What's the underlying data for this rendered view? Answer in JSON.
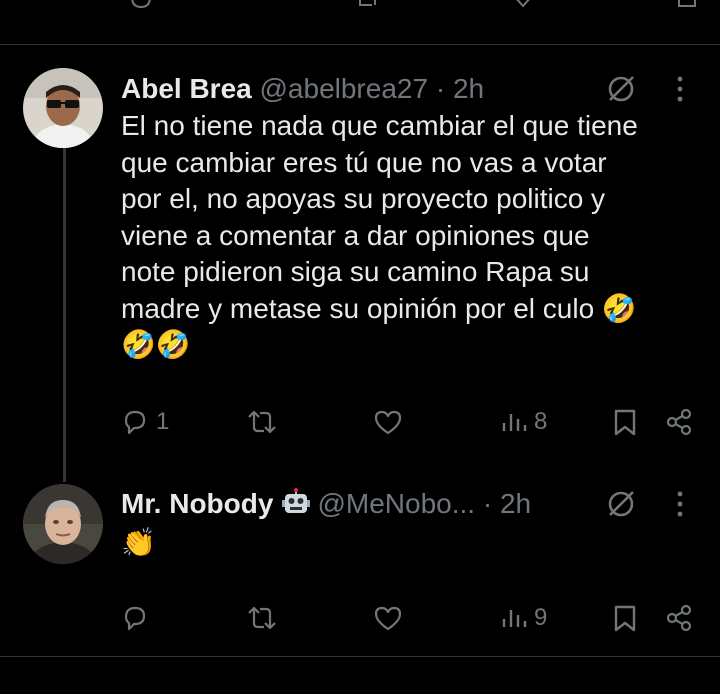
{
  "tweets": [
    {
      "name": "Abel Brea",
      "handle": "@abelbrea27",
      "separator": "·",
      "time": "2h",
      "text_lines": [
        "El no tiene nada que cambiar el que tiene",
        "que cambiar eres tú que no vas a votar",
        "por el, no apoyas su proyecto politico y",
        "viene a comentar a dar opiniones que",
        "note pidieron  siga su camino Rapa su",
        "madre y metase su opinión por el culo 🤣",
        "🤣🤣"
      ],
      "replies": "1",
      "reposts": "",
      "likes": "",
      "views": "8"
    },
    {
      "name": "Mr. Nobody",
      "name_badge_icon": "robot-icon",
      "handle": "@MeNobo...",
      "separator": "·",
      "time": "2h",
      "text_lines": [
        "👏"
      ],
      "replies": "",
      "reposts": "",
      "likes": "",
      "views": "9"
    }
  ],
  "colors": {
    "background": "#000000",
    "text": "#e7e9ea",
    "secondary": "#71767b",
    "divider": "#2f3336",
    "thread_line": "#333639"
  }
}
